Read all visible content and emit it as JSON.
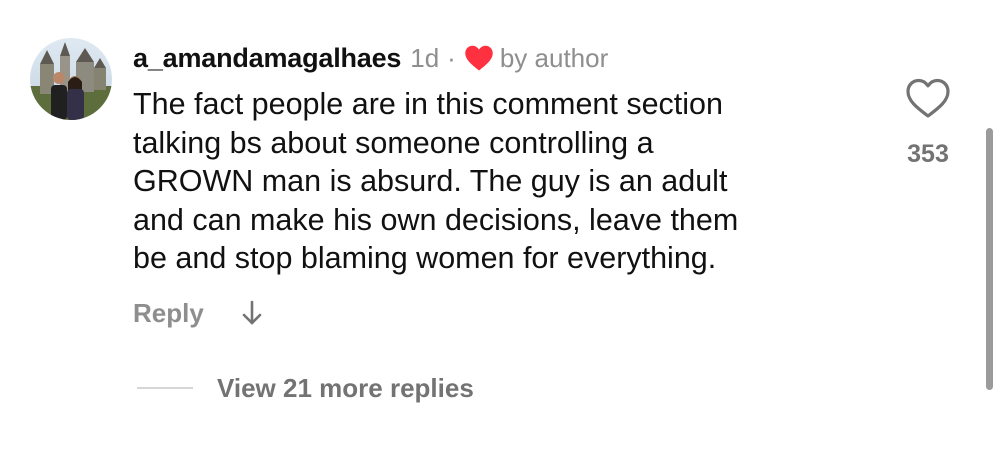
{
  "comment": {
    "username": "a_amandamagalhaes",
    "time": "1d",
    "separator": "·",
    "liked_by_author_label": "by author",
    "body_lines": [
      "The fact people are in this comment section",
      "talking bs about someone controlling a",
      "GROWN man is absurd. The guy is an adult",
      "and can make his own decisions, leave them",
      "be and stop blaming women for everything."
    ],
    "like_count": "353",
    "reply_label": "Reply"
  },
  "replies": {
    "view_more_label": "View 21 more replies"
  },
  "icons": {
    "author_heart": "heart-filled-icon",
    "like": "heart-outline-icon",
    "expand": "arrow-down-icon"
  },
  "colors": {
    "author_heart": "#ff3040",
    "secondary_text": "#8e8e8e",
    "primary_text": "#111111"
  }
}
